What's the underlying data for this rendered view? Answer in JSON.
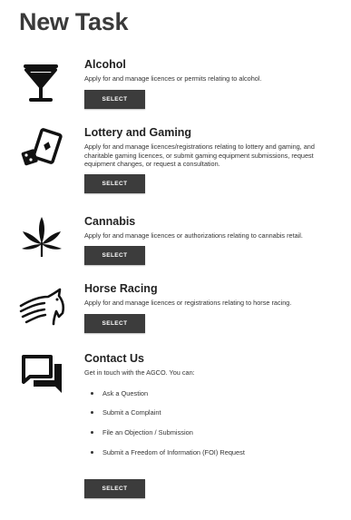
{
  "page": {
    "title": "New Task"
  },
  "tasks": [
    {
      "icon": "cocktail-glass-icon",
      "title": "Alcohol",
      "description": "Apply for and manage licences or permits relating to alcohol.",
      "button": "SELECT"
    },
    {
      "icon": "playing-cards-dice-icon",
      "title": "Lottery and Gaming",
      "description": "Apply for and manage licences/registrations relating to lottery and gaming, and charitable gaming licences, or submit gaming equipment submissions, request equipment changes, or request a consultation.",
      "button": "SELECT"
    },
    {
      "icon": "cannabis-leaf-icon",
      "title": "Cannabis",
      "description": "Apply for and manage licences or authorizations relating to cannabis retail.",
      "button": "SELECT"
    },
    {
      "icon": "horse-head-icon",
      "title": "Horse Racing",
      "description": "Apply for and manage licences or registrations relating to horse racing.",
      "button": "SELECT"
    },
    {
      "icon": "chat-bubbles-icon",
      "title": "Contact Us",
      "description": "Get in touch with the AGCO. You can:",
      "options": [
        "Ask a Question",
        "Submit a Complaint",
        "File an Objection / Submission",
        "Submit a Freedom of Information (FOI) Request"
      ],
      "button": "SELECT"
    }
  ],
  "colors": {
    "button": "#3c3c3c",
    "title": "#3a3a3a",
    "icon": "#111111"
  }
}
